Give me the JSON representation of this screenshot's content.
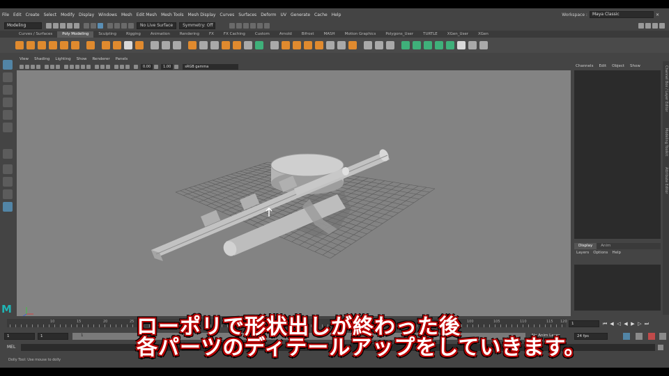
{
  "menu": [
    "File",
    "Edit",
    "Create",
    "Select",
    "Modify",
    "Display",
    "Windows",
    "Mesh",
    "Edit Mesh",
    "Mesh Tools",
    "Mesh Display",
    "Curves",
    "Surfaces",
    "Deform",
    "UV",
    "Generate",
    "Cache",
    "Help"
  ],
  "workspace": {
    "label": "Workspace :",
    "value": "Maya Classic"
  },
  "status": {
    "mode": "Modeling",
    "live_surface": "No Live Surface",
    "symmetry": "Symmetry: Off"
  },
  "shelf_tabs": [
    "Curves / Surfaces",
    "Poly Modeling",
    "Sculpting",
    "Rigging",
    "Animation",
    "Rendering",
    "FX",
    "FX Caching",
    "Custom",
    "Arnold",
    "Bifrost",
    "MASH",
    "Motion Graphics",
    "Polygons_User",
    "TURTLE",
    "XGen_User",
    "XGen"
  ],
  "shelf_active": "Poly Modeling",
  "panel_menu": [
    "View",
    "Shading",
    "Lighting",
    "Show",
    "Renderer",
    "Panels"
  ],
  "viewport_toolbar": {
    "value1": "0.00",
    "value2": "1.00",
    "colorspace": "sRGB gamma"
  },
  "channel_box": {
    "menu": [
      "Channels",
      "Edit",
      "Object",
      "Show"
    ]
  },
  "layer_editor": {
    "tabs": [
      "Display",
      "Anim"
    ],
    "menu": [
      "Layers",
      "Options",
      "Help"
    ]
  },
  "side_tabs": [
    "Channel Box / Layer Editor",
    "Modeling Toolkit",
    "Attribute Editor"
  ],
  "time_slider": {
    "ticks": [
      "10",
      "15",
      "20",
      "25",
      "100",
      "105",
      "110",
      "115",
      "120"
    ],
    "current_frame": "1"
  },
  "range_slider": {
    "start": "1",
    "inner_start": "1",
    "bar_start": "1",
    "anim_layer": "No Anim Layer",
    "fps": "24 fps"
  },
  "command_line": {
    "label": "MEL"
  },
  "help_line": "Dolly Tool: Use mouse to dolly",
  "subtitles": [
    "ローポリで形状出しが終わった後",
    "各パーツのディテールアップをしていきます。"
  ]
}
